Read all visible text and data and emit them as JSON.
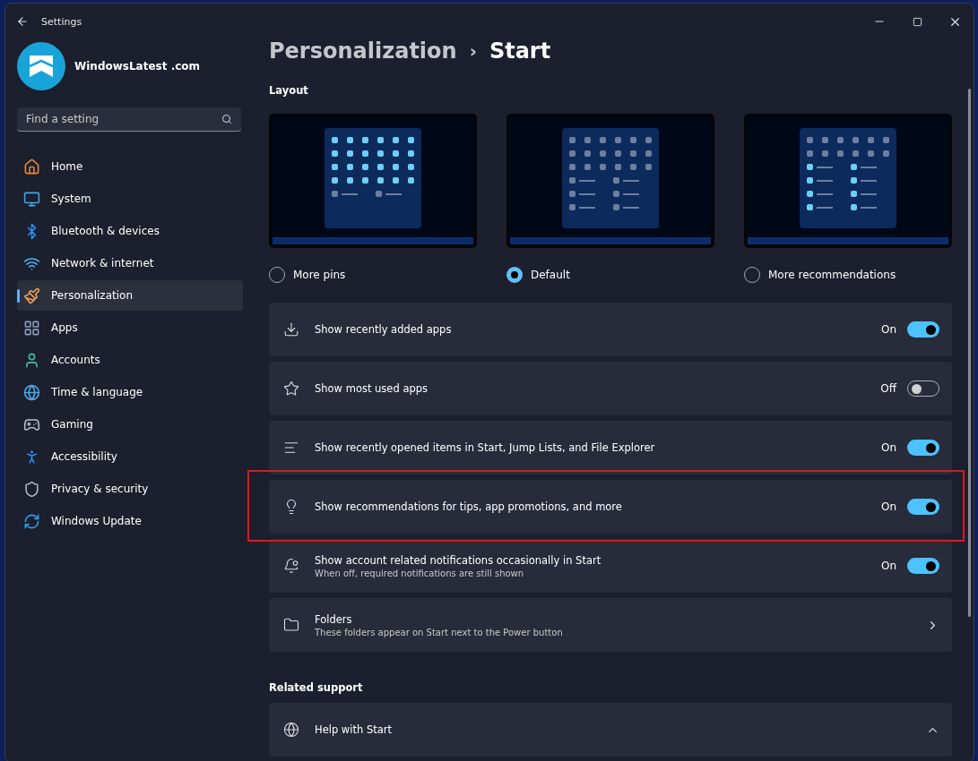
{
  "window": {
    "title": "Settings"
  },
  "account": {
    "name": "WindowsLatest .com"
  },
  "search": {
    "placeholder": "Find a setting"
  },
  "nav": [
    {
      "label": "Home",
      "selected": false
    },
    {
      "label": "System",
      "selected": false
    },
    {
      "label": "Bluetooth & devices",
      "selected": false
    },
    {
      "label": "Network & internet",
      "selected": false
    },
    {
      "label": "Personalization",
      "selected": true
    },
    {
      "label": "Apps",
      "selected": false
    },
    {
      "label": "Accounts",
      "selected": false
    },
    {
      "label": "Time & language",
      "selected": false
    },
    {
      "label": "Gaming",
      "selected": false
    },
    {
      "label": "Accessibility",
      "selected": false
    },
    {
      "label": "Privacy & security",
      "selected": false
    },
    {
      "label": "Windows Update",
      "selected": false
    }
  ],
  "breadcrumb": {
    "parent": "Personalization",
    "separator": "›",
    "current": "Start"
  },
  "layout": {
    "heading": "Layout",
    "options": [
      {
        "label": "More pins",
        "kind": "pins",
        "selected": false
      },
      {
        "label": "Default",
        "kind": "default",
        "selected": true
      },
      {
        "label": "More recommendations",
        "kind": "recommendations",
        "selected": false
      }
    ]
  },
  "settings": [
    {
      "kind": "toggle",
      "title": "Show recently added apps",
      "state_label": "On",
      "on": true,
      "highlighted": false
    },
    {
      "kind": "toggle",
      "title": "Show most used apps",
      "state_label": "Off",
      "on": false,
      "highlighted": false
    },
    {
      "kind": "toggle",
      "title": "Show recently opened items in Start, Jump Lists, and File Explorer",
      "state_label": "On",
      "on": true,
      "highlighted": false
    },
    {
      "kind": "toggle",
      "title": "Show recommendations for tips, app promotions, and more",
      "state_label": "On",
      "on": true,
      "highlighted": true
    },
    {
      "kind": "toggle",
      "title": "Show account related notifications occasionally in Start",
      "subtitle": "When off, required notifications are still shown",
      "state_label": "On",
      "on": true,
      "highlighted": false
    },
    {
      "kind": "link",
      "title": "Folders",
      "subtitle": "These folders appear on Start next to the Power button",
      "highlighted": false
    }
  ],
  "related": {
    "heading": "Related support",
    "items": [
      {
        "title": "Help with Start",
        "expanded": true
      }
    ]
  }
}
